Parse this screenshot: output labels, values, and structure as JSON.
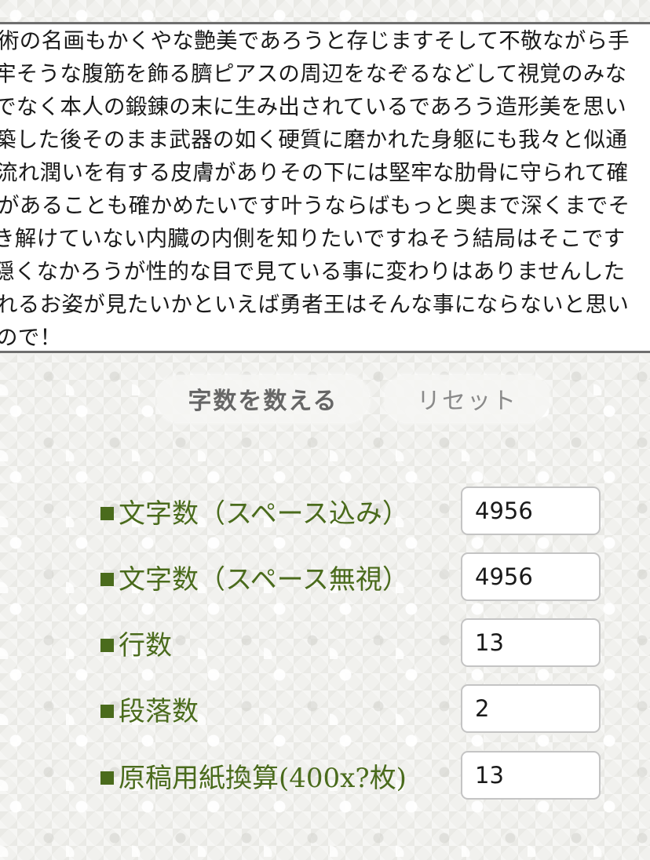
{
  "editor": {
    "lines": [
      "術の名画もかくやな艶美であろうと存じますそして不敬ながら手",
      "牢そうな腹筋を飾る臍ピアスの周辺をなぞるなどして視覚のみな",
      "でなく本人の鍛錬の末に生み出されているであろう造形美を思い",
      "築した後そのまま武器の如く硬質に磨かれた身躯にも我々と似通",
      "流れ潤いを有する皮膚がありその下には堅牢な肋骨に守られて確",
      "があることも確かめたいです叶うならばもっと奥まで深くまでそ",
      "き解けていない内臓の内側を知りたいですねそう結局はそこです",
      "隠くなかろうが性的な目で見ている事に変わりはありませんした",
      "れるお姿が見たいかといえば勇者王はそんな事にならないと思い",
      "ので！"
    ]
  },
  "buttons": {
    "count_label": "字数を数える",
    "reset_label": "リセット"
  },
  "stats": [
    {
      "label": "文字数（スペース込み）",
      "value": "4956"
    },
    {
      "label": "文字数（スペース無視）",
      "value": "4956"
    },
    {
      "label": "行数",
      "value": "13"
    },
    {
      "label": "段落数",
      "value": "2"
    },
    {
      "label": "原稿用紙換算(400x?枚)",
      "value": "13"
    }
  ],
  "colors": {
    "label_green": "#4a6b1c",
    "button_text": "#6d6d6d"
  }
}
